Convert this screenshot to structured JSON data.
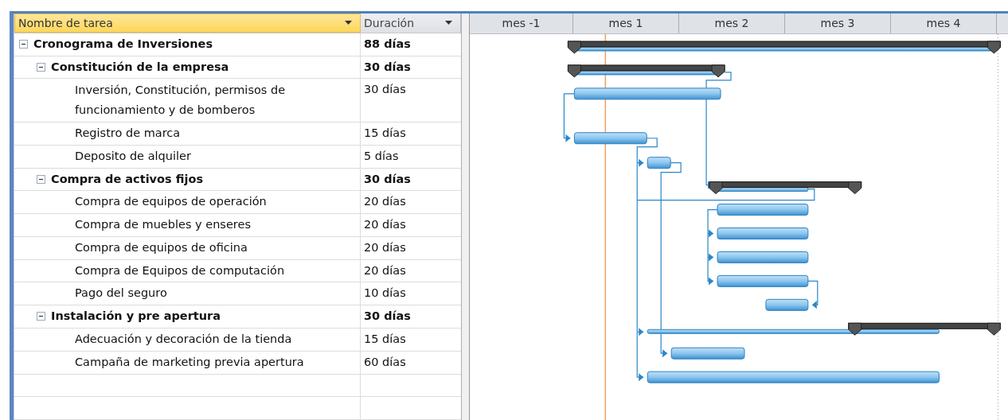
{
  "columns": [
    {
      "label": "Nombre de tarea",
      "selected": true
    },
    {
      "label": "Duración",
      "selected": false
    }
  ],
  "timescale": [
    "mes -1",
    "mes 1",
    "mes 2",
    "mes 3",
    "mes 4"
  ],
  "tasks": [
    {
      "name": "Cronograma de Inversiones",
      "duration": "88 días",
      "expanded": true,
      "children": [
        {
          "name": "Constitución de la empresa",
          "duration": "30 días",
          "expanded": true,
          "children": [
            {
              "name": "Inversión, Constitución, permisos de funcionamiento y de bomberos",
              "duration": "30 días"
            },
            {
              "name": "Registro de marca",
              "duration": "15 días"
            },
            {
              "name": "Deposito de alquiler",
              "duration": "5 días"
            }
          ]
        },
        {
          "name": "Compra de activos fijos",
          "duration": "30 días",
          "expanded": true,
          "children": [
            {
              "name": "Compra de equipos de operación",
              "duration": "20 días"
            },
            {
              "name": "Compra de muebles y enseres",
              "duration": "20 días"
            },
            {
              "name": "Compra de equipos de oficina",
              "duration": "20 días"
            },
            {
              "name": "Compra de Equipos de computación",
              "duration": "20 días"
            },
            {
              "name": "Pago del seguro",
              "duration": "10 días"
            }
          ]
        },
        {
          "name": "Instalación y pre apertura",
          "duration": "30 días",
          "expanded": true,
          "children": [
            {
              "name": "Adecuación y decoración de la tienda",
              "duration": "15 días"
            },
            {
              "name": "Campaña de marketing previa apertura",
              "duration": "60 días"
            }
          ]
        }
      ]
    }
  ]
}
